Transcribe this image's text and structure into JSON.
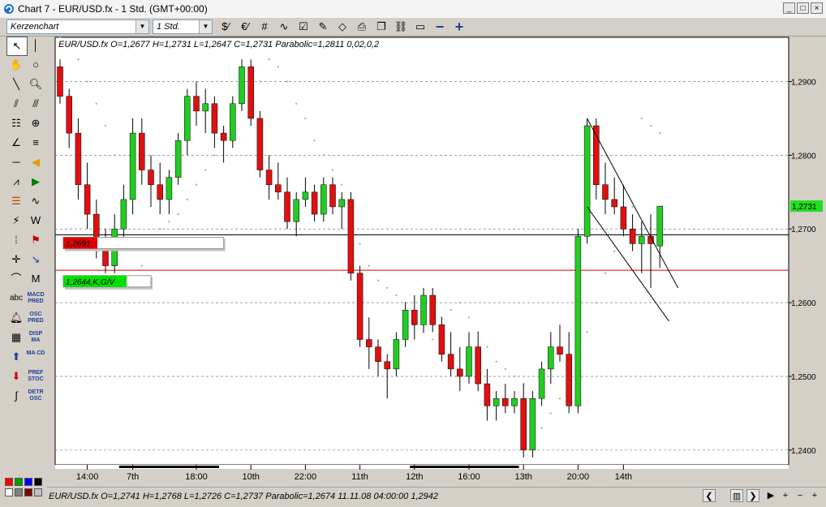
{
  "window": {
    "title": "Chart 7 - EUR/USD.fx - 1 Std. (GMT+00:00)",
    "minimize": "_",
    "maximize": "□",
    "close": "×"
  },
  "toolbar": {
    "chart_type": "Kerzenchart",
    "timeframe": "1 Std."
  },
  "chart_data": {
    "type": "candlestick",
    "info": "EUR/USD.fx O=1,2677 H=1,2731 L=1,2647 C=1,2731   Parabolic=1,2811  0,02,0,2",
    "ylim": [
      1.238,
      1.296
    ],
    "y_ticks": [
      1.24,
      1.25,
      1.26,
      1.27,
      1.28,
      1.29
    ],
    "y_tick_labels": [
      "1,2400",
      "1,2500",
      "1,2600",
      "1,2700",
      "1,2800",
      "1,2900"
    ],
    "x_labels": [
      {
        "i": 3,
        "text": "14:00"
      },
      {
        "i": 8,
        "text": "7th"
      },
      {
        "i": 15,
        "text": "18:00"
      },
      {
        "i": 21,
        "text": "10th"
      },
      {
        "i": 27,
        "text": "22:00"
      },
      {
        "i": 33,
        "text": "11th"
      },
      {
        "i": 39,
        "text": "12th"
      },
      {
        "i": 45,
        "text": "16:00"
      },
      {
        "i": 51,
        "text": "13th"
      },
      {
        "i": 57,
        "text": "20:00"
      },
      {
        "i": 62,
        "text": "14th"
      }
    ],
    "candles": [
      {
        "o": 1.292,
        "h": 1.293,
        "l": 1.287,
        "c": 1.288
      },
      {
        "o": 1.288,
        "h": 1.289,
        "l": 1.281,
        "c": 1.283
      },
      {
        "o": 1.283,
        "h": 1.285,
        "l": 1.274,
        "c": 1.276
      },
      {
        "o": 1.276,
        "h": 1.279,
        "l": 1.27,
        "c": 1.272
      },
      {
        "o": 1.272,
        "h": 1.274,
        "l": 1.266,
        "c": 1.268
      },
      {
        "o": 1.268,
        "h": 1.27,
        "l": 1.264,
        "c": 1.265
      },
      {
        "o": 1.265,
        "h": 1.272,
        "l": 1.264,
        "c": 1.27
      },
      {
        "o": 1.27,
        "h": 1.276,
        "l": 1.268,
        "c": 1.274
      },
      {
        "o": 1.274,
        "h": 1.285,
        "l": 1.272,
        "c": 1.283
      },
      {
        "o": 1.283,
        "h": 1.285,
        "l": 1.276,
        "c": 1.278
      },
      {
        "o": 1.278,
        "h": 1.28,
        "l": 1.273,
        "c": 1.276
      },
      {
        "o": 1.276,
        "h": 1.279,
        "l": 1.272,
        "c": 1.274
      },
      {
        "o": 1.274,
        "h": 1.278,
        "l": 1.272,
        "c": 1.277
      },
      {
        "o": 1.277,
        "h": 1.283,
        "l": 1.276,
        "c": 1.282
      },
      {
        "o": 1.282,
        "h": 1.289,
        "l": 1.28,
        "c": 1.288
      },
      {
        "o": 1.288,
        "h": 1.29,
        "l": 1.284,
        "c": 1.286
      },
      {
        "o": 1.286,
        "h": 1.289,
        "l": 1.283,
        "c": 1.287
      },
      {
        "o": 1.287,
        "h": 1.288,
        "l": 1.281,
        "c": 1.283
      },
      {
        "o": 1.283,
        "h": 1.284,
        "l": 1.279,
        "c": 1.282
      },
      {
        "o": 1.282,
        "h": 1.288,
        "l": 1.281,
        "c": 1.287
      },
      {
        "o": 1.287,
        "h": 1.293,
        "l": 1.286,
        "c": 1.292
      },
      {
        "o": 1.292,
        "h": 1.293,
        "l": 1.284,
        "c": 1.285
      },
      {
        "o": 1.285,
        "h": 1.286,
        "l": 1.277,
        "c": 1.278
      },
      {
        "o": 1.278,
        "h": 1.28,
        "l": 1.274,
        "c": 1.276
      },
      {
        "o": 1.276,
        "h": 1.279,
        "l": 1.274,
        "c": 1.275
      },
      {
        "o": 1.275,
        "h": 1.277,
        "l": 1.27,
        "c": 1.271
      },
      {
        "o": 1.271,
        "h": 1.275,
        "l": 1.269,
        "c": 1.274
      },
      {
        "o": 1.274,
        "h": 1.277,
        "l": 1.273,
        "c": 1.275
      },
      {
        "o": 1.275,
        "h": 1.276,
        "l": 1.271,
        "c": 1.272
      },
      {
        "o": 1.272,
        "h": 1.277,
        "l": 1.271,
        "c": 1.276
      },
      {
        "o": 1.276,
        "h": 1.277,
        "l": 1.272,
        "c": 1.273
      },
      {
        "o": 1.273,
        "h": 1.275,
        "l": 1.27,
        "c": 1.274
      },
      {
        "o": 1.274,
        "h": 1.275,
        "l": 1.263,
        "c": 1.264
      },
      {
        "o": 1.264,
        "h": 1.265,
        "l": 1.254,
        "c": 1.255
      },
      {
        "o": 1.255,
        "h": 1.258,
        "l": 1.251,
        "c": 1.254
      },
      {
        "o": 1.254,
        "h": 1.255,
        "l": 1.25,
        "c": 1.252
      },
      {
        "o": 1.252,
        "h": 1.253,
        "l": 1.247,
        "c": 1.251
      },
      {
        "o": 1.251,
        "h": 1.256,
        "l": 1.25,
        "c": 1.255
      },
      {
        "o": 1.255,
        "h": 1.26,
        "l": 1.254,
        "c": 1.259
      },
      {
        "o": 1.259,
        "h": 1.261,
        "l": 1.255,
        "c": 1.257
      },
      {
        "o": 1.257,
        "h": 1.262,
        "l": 1.256,
        "c": 1.261
      },
      {
        "o": 1.261,
        "h": 1.262,
        "l": 1.256,
        "c": 1.257
      },
      {
        "o": 1.257,
        "h": 1.258,
        "l": 1.252,
        "c": 1.253
      },
      {
        "o": 1.253,
        "h": 1.256,
        "l": 1.25,
        "c": 1.251
      },
      {
        "o": 1.251,
        "h": 1.254,
        "l": 1.248,
        "c": 1.25
      },
      {
        "o": 1.25,
        "h": 1.256,
        "l": 1.249,
        "c": 1.254
      },
      {
        "o": 1.254,
        "h": 1.256,
        "l": 1.248,
        "c": 1.249
      },
      {
        "o": 1.249,
        "h": 1.251,
        "l": 1.244,
        "c": 1.246
      },
      {
        "o": 1.246,
        "h": 1.248,
        "l": 1.244,
        "c": 1.247
      },
      {
        "o": 1.247,
        "h": 1.249,
        "l": 1.245,
        "c": 1.246
      },
      {
        "o": 1.246,
        "h": 1.248,
        "l": 1.245,
        "c": 1.247
      },
      {
        "o": 1.247,
        "h": 1.249,
        "l": 1.239,
        "c": 1.24
      },
      {
        "o": 1.24,
        "h": 1.248,
        "l": 1.239,
        "c": 1.247
      },
      {
        "o": 1.247,
        "h": 1.252,
        "l": 1.246,
        "c": 1.251
      },
      {
        "o": 1.251,
        "h": 1.256,
        "l": 1.249,
        "c": 1.254
      },
      {
        "o": 1.254,
        "h": 1.257,
        "l": 1.252,
        "c": 1.253
      },
      {
        "o": 1.253,
        "h": 1.256,
        "l": 1.245,
        "c": 1.246
      },
      {
        "o": 1.246,
        "h": 1.27,
        "l": 1.245,
        "c": 1.269
      },
      {
        "o": 1.269,
        "h": 1.285,
        "l": 1.268,
        "c": 1.284
      },
      {
        "o": 1.284,
        "h": 1.285,
        "l": 1.274,
        "c": 1.276
      },
      {
        "o": 1.276,
        "h": 1.279,
        "l": 1.272,
        "c": 1.274
      },
      {
        "o": 1.274,
        "h": 1.277,
        "l": 1.272,
        "c": 1.273
      },
      {
        "o": 1.273,
        "h": 1.276,
        "l": 1.269,
        "c": 1.27
      },
      {
        "o": 1.27,
        "h": 1.272,
        "l": 1.267,
        "c": 1.268
      },
      {
        "o": 1.268,
        "h": 1.271,
        "l": 1.264,
        "c": 1.269
      },
      {
        "o": 1.269,
        "h": 1.272,
        "l": 1.262,
        "c": 1.268
      },
      {
        "o": 1.2677,
        "h": 1.2731,
        "l": 1.2647,
        "c": 1.2731
      }
    ],
    "sar": [
      1.296,
      1.295,
      1.293,
      1.29,
      1.287,
      1.284,
      1.28,
      1.262,
      1.263,
      1.265,
      1.268,
      1.27,
      1.271,
      1.272,
      1.274,
      1.276,
      1.278,
      1.28,
      1.283,
      1.285,
      1.287,
      1.288,
      1.29,
      1.293,
      1.292,
      1.29,
      1.287,
      1.285,
      1.282,
      1.28,
      1.278,
      1.276,
      1.272,
      1.268,
      1.265,
      1.263,
      1.262,
      1.261,
      1.26,
      1.257,
      1.256,
      1.255,
      1.258,
      1.259,
      1.26,
      1.258,
      1.256,
      1.254,
      1.252,
      1.251,
      1.25,
      1.249,
      1.241,
      1.243,
      1.245,
      1.247,
      1.249,
      1.252,
      1.256,
      1.26,
      1.264,
      1.267,
      1.27,
      1.273,
      1.285,
      1.284,
      1.283
    ],
    "last_price_label": "1,2731",
    "horizontal_lines": [
      {
        "y": 1.2692,
        "color": "#000000"
      },
      {
        "y": 1.2644,
        "color": "#e00000"
      }
    ],
    "price_labels": [
      {
        "text": "1,2691",
        "y": 1.2681,
        "from": 0,
        "to": 18,
        "color": "#e00000"
      },
      {
        "text": "1,2644,K,G/V",
        "y": 1.2629,
        "from": 0,
        "to": 10,
        "color": "#00e000"
      }
    ],
    "trend_lines": [
      {
        "i1": 58,
        "y1": 1.285,
        "i2": 68,
        "y2": 1.262
      },
      {
        "i1": 58,
        "y1": 1.273,
        "i2": 67,
        "y2": 1.2575
      }
    ],
    "colors": {
      "up": "#22cc22",
      "down": "#e01010",
      "sar": "#b0b0b0",
      "grid": "#808080"
    }
  },
  "status": {
    "text": "EUR/USD.fx O=1,2741 H=1,2768 L=1,2726 C=1,2737  Parabolic=1,2674  11.11.08 04:00:00 1,2942"
  }
}
